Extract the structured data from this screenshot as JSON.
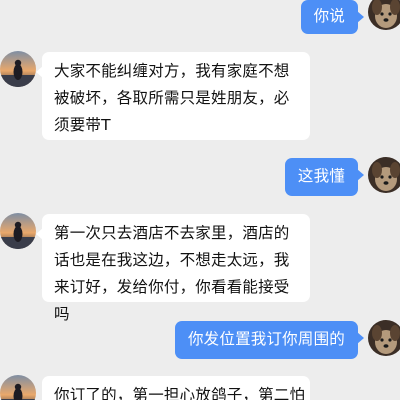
{
  "messages": [
    {
      "side": "out",
      "text": "你说"
    },
    {
      "side": "in",
      "text": "大家不能纠缠对方，我有家庭不想被破坏，各取所需只是姓朋友，必须要带T"
    },
    {
      "side": "out",
      "text": "这我懂"
    },
    {
      "side": "in",
      "text": "第一次只去酒店不去家里，酒店的话也是在我这边，不想走太远，我来订好，发给你付，你看看能接受吗"
    },
    {
      "side": "out",
      "text": "你发位置我订你周围的"
    },
    {
      "side": "in",
      "text": "你订了的，第一担心放鸽子，第二怕"
    }
  ],
  "colors": {
    "background": "#ededed",
    "incoming_bubble": "#ffffff",
    "outgoing_bubble": "#4d8ff6"
  }
}
